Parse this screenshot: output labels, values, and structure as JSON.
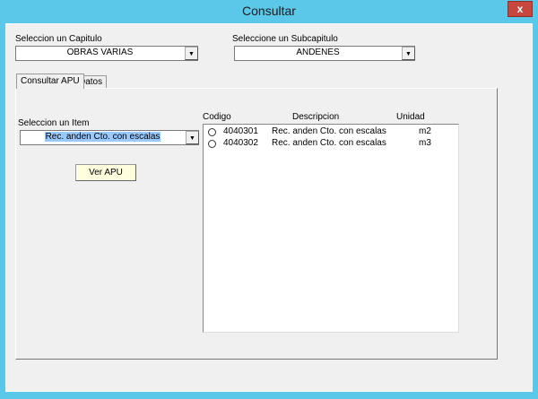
{
  "window": {
    "title": "Consultar",
    "close_label": "x"
  },
  "capitulo": {
    "label": "Seleccion un Capitulo",
    "value": "OBRAS VARIAS"
  },
  "subcapitulo": {
    "label": "Seleccione un Subcapitulo",
    "value": "ANDENES"
  },
  "tabs": [
    {
      "label": "Consultar APU"
    },
    {
      "label": "Datos"
    }
  ],
  "item": {
    "label": "Seleccion un Item",
    "value": "Rec. anden Cto. con escalas"
  },
  "ver_apu": "Ver APU",
  "list": {
    "headers": [
      "Codigo",
      "Descripcion",
      "Unidad"
    ],
    "rows": [
      {
        "codigo": "4040301",
        "descripcion": "Rec. anden Cto. con escalas",
        "unidad": "m2"
      },
      {
        "codigo": "4040302",
        "descripcion": "Rec. anden Cto. con escalas",
        "unidad": "m3"
      }
    ]
  }
}
